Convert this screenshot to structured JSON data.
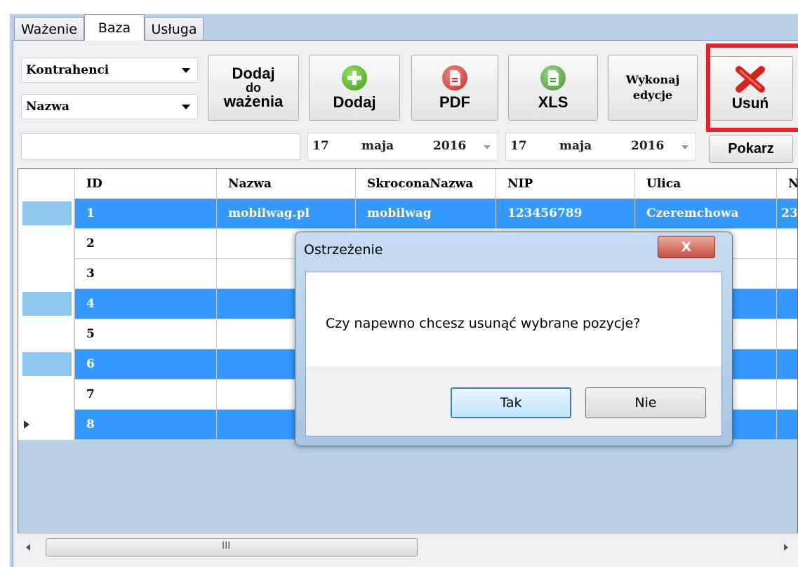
{
  "tabs": [
    {
      "label": "Ważenie"
    },
    {
      "label": "Baza",
      "active": true
    },
    {
      "label": "Usługa"
    }
  ],
  "toolbar": {
    "combo_type": "Kontrahenci",
    "combo_field": "Nazwa",
    "add_to_weighing": [
      "Dodaj",
      "do",
      "ważenia"
    ],
    "add": "Dodaj",
    "pdf": "PDF",
    "xls": "XLS",
    "edit": [
      "Wykonaj",
      "edycje"
    ],
    "delete": "Usuń",
    "search_value": "",
    "date_from": {
      "day": "17",
      "month": "maja",
      "year": "2016"
    },
    "date_to": {
      "day": "17",
      "month": "maja",
      "year": "2016"
    },
    "show": "Pokarz"
  },
  "grid": {
    "columns": [
      "ID",
      "Nazwa",
      "SkroconaNazwa",
      "NIP",
      "Ulica",
      "N"
    ],
    "rows": [
      {
        "id": "1",
        "nazwa": "mobilwag.pl",
        "skrocona": "mobilwag",
        "nip": "123456789",
        "ulica": "Czeremchowa",
        "n": "23",
        "selected": true
      },
      {
        "id": "2",
        "selected": false
      },
      {
        "id": "3",
        "selected": false
      },
      {
        "id": "4",
        "selected": true
      },
      {
        "id": "5",
        "selected": false
      },
      {
        "id": "6",
        "selected": true
      },
      {
        "id": "7",
        "selected": false
      },
      {
        "id": "8",
        "selected": true,
        "current": true
      }
    ],
    "scroll_thumb": "III"
  },
  "dialog": {
    "title": "Ostrzeżenie",
    "close_label": "X",
    "message": "Czy napewno chcesz usunąć wybrane pozycje?",
    "yes": "Tak",
    "no": "Nie"
  },
  "colors": {
    "selection": "#3399ff",
    "window_bg": "#b9cfe6",
    "highlight": "#e8202a"
  }
}
